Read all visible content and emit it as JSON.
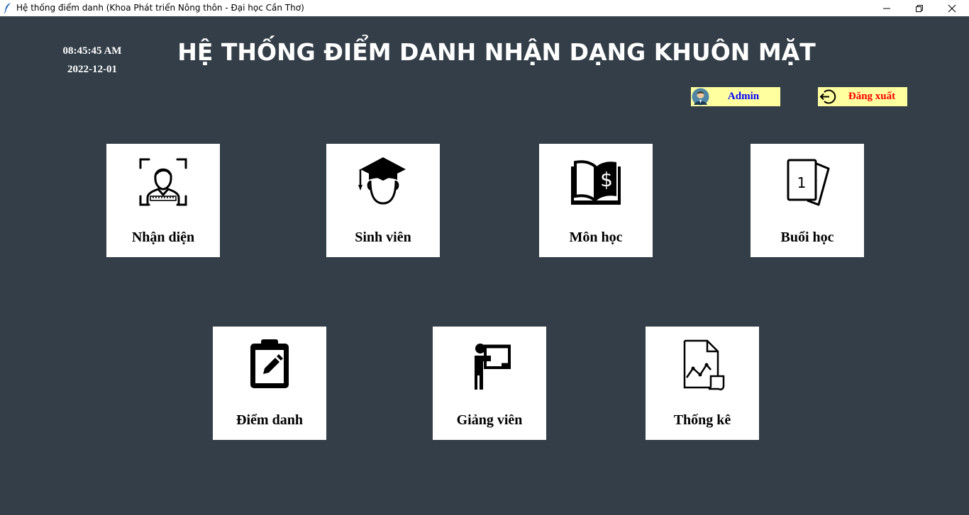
{
  "window": {
    "title": "Hệ thống điểm danh (Khoa Phát triển Nông thôn - Đại học Cần Thơ)"
  },
  "clock": {
    "time": "08:45:45 AM",
    "date": "2022-12-01"
  },
  "header": {
    "title": "HỆ THỐNG ĐIỂM DANH NHẬN DẠNG KHUÔN MẶT"
  },
  "account": {
    "admin_label": "Admin",
    "logout_label": "Đăng xuất"
  },
  "colors": {
    "background": "#333e48",
    "pill_background": "#ffffa0",
    "admin_text": "#0000ff",
    "logout_text": "#ff0000"
  },
  "menu": {
    "tiles": [
      {
        "label": "Nhận diện",
        "icon": "face-scan-icon"
      },
      {
        "label": "Sinh viên",
        "icon": "graduate-icon"
      },
      {
        "label": "Môn học",
        "icon": "book-dollar-icon"
      },
      {
        "label": "Buổi học",
        "icon": "cards-icon"
      },
      {
        "label": "Điểm danh",
        "icon": "clipboard-edit-icon"
      },
      {
        "label": "Giảng viên",
        "icon": "teacher-board-icon"
      },
      {
        "label": "Thống kê",
        "icon": "report-chart-icon"
      }
    ]
  }
}
